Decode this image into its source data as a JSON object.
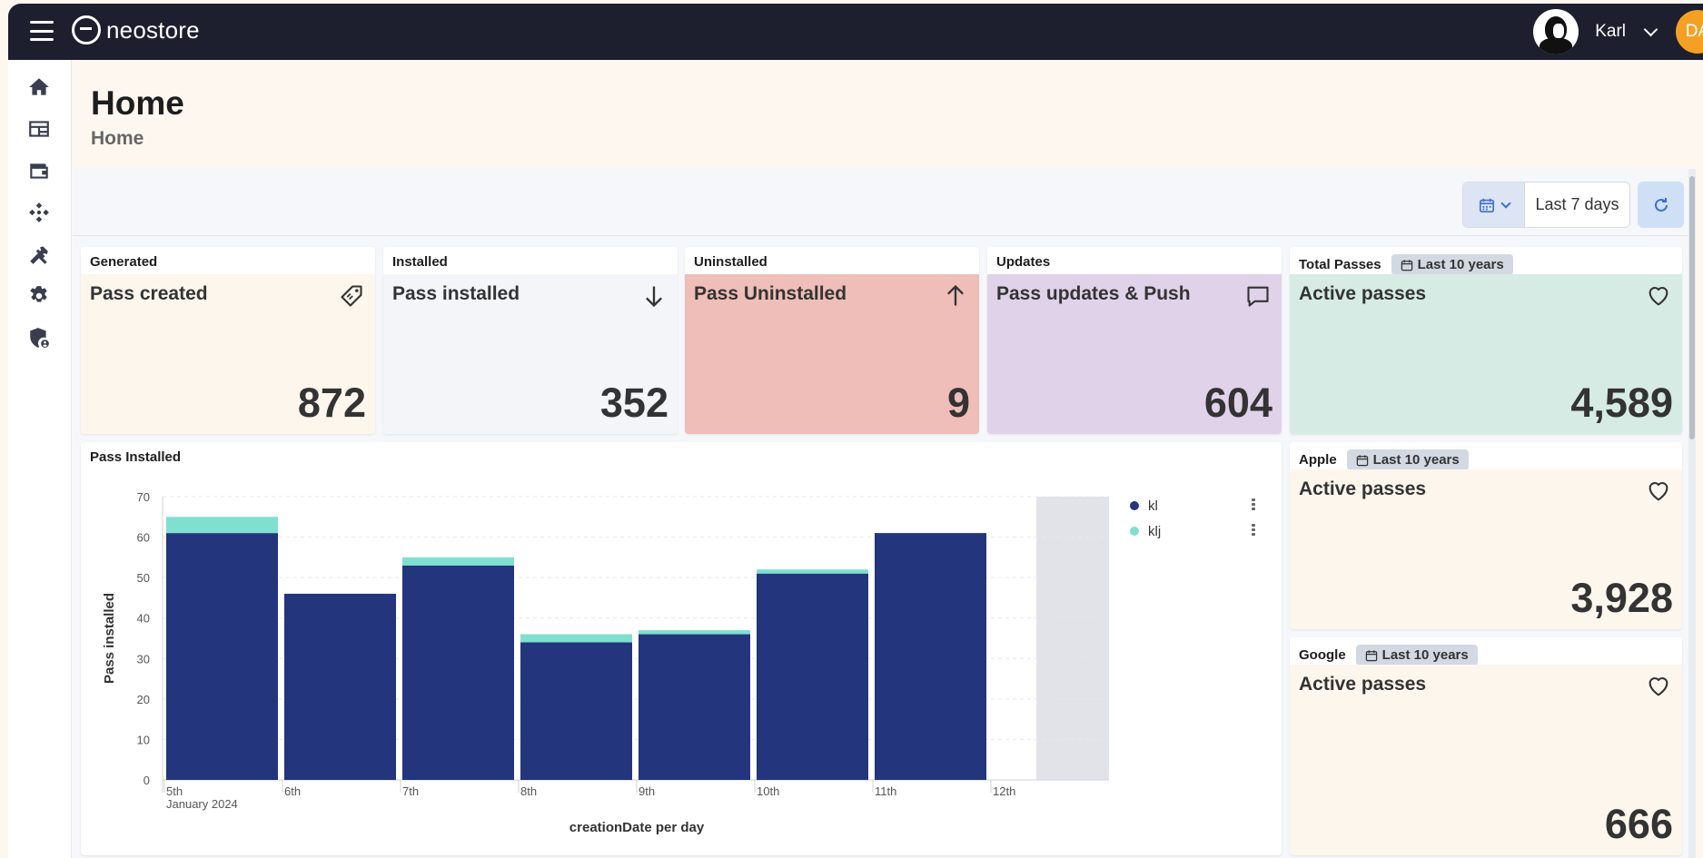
{
  "app": {
    "name": "neostore"
  },
  "user": {
    "name": "Karl",
    "org_initials": "DA"
  },
  "sidebar": {
    "items": [
      {
        "icon": "home-icon"
      },
      {
        "icon": "dashboard-icon"
      },
      {
        "icon": "wallet-icon"
      },
      {
        "icon": "integrations-icon"
      },
      {
        "icon": "tools-icon"
      },
      {
        "icon": "settings-icon"
      },
      {
        "icon": "security-icon"
      }
    ]
  },
  "header": {
    "title": "Home",
    "breadcrumb": "Home"
  },
  "toolbar": {
    "date_range": "Last 7 days"
  },
  "stats": [
    {
      "label": "Generated",
      "title": "Pass created",
      "value": "872",
      "icon": "tag-icon",
      "bg": "#fdf6ed"
    },
    {
      "label": "Installed",
      "title": "Pass installed",
      "value": "352",
      "icon": "arrow-down-icon",
      "bg": "#f3f5f9"
    },
    {
      "label": "Uninstalled",
      "title": "Pass Uninstalled",
      "value": "9",
      "icon": "arrow-up-icon",
      "bg": "#efbeb8"
    },
    {
      "label": "Updates",
      "title": "Pass updates & Push",
      "value": "604",
      "icon": "message-icon",
      "bg": "#dfd2e9"
    }
  ],
  "totals": [
    {
      "label": "Total Passes",
      "badge": "Last 10 years",
      "title": "Active passes",
      "value": "4,589",
      "icon": "heart-icon",
      "bg": "#d6ebe4"
    },
    {
      "label": "Apple",
      "badge": "Last 10 years",
      "title": "Active passes",
      "value": "3,928",
      "icon": "heart-icon",
      "bg": "#fdf6ed"
    },
    {
      "label": "Google",
      "badge": "Last 10 years",
      "title": "Active passes",
      "value": "666",
      "icon": "heart-icon",
      "bg": "#fdf6ed"
    }
  ],
  "chart_panel": {
    "title": "Pass Installed"
  },
  "chart_data": {
    "type": "bar",
    "stacked": true,
    "categories": [
      "5th",
      "6th",
      "7th",
      "8th",
      "9th",
      "10th",
      "11th",
      "12th"
    ],
    "first_tick_sublabel": "January 2024",
    "series": [
      {
        "name": "kl",
        "color": "#22357d",
        "values": [
          61,
          46,
          53,
          34,
          36,
          51,
          61,
          0
        ]
      },
      {
        "name": "klj",
        "color": "#7fe0cf",
        "values": [
          4,
          0,
          2,
          2,
          1,
          1,
          0,
          0
        ]
      }
    ],
    "ylim": [
      0,
      70
    ],
    "yticks": [
      0,
      10,
      20,
      30,
      40,
      50,
      60,
      70
    ],
    "ylabel": "Pass installed",
    "xlabel": "creationDate per day",
    "grid": true,
    "legend_position": "top-right",
    "highlight_region_color": "#e1e3e8"
  }
}
